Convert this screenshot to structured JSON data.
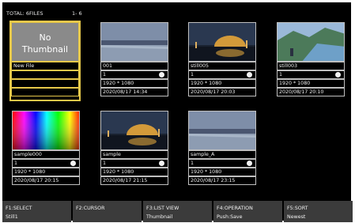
{
  "header": {
    "total": "TOTAL: 6FILES",
    "range": "1- 6"
  },
  "cards": [
    {
      "name": "New File",
      "no_thumb": "No\nThumbnail",
      "thumb": "none",
      "selected": true
    },
    {
      "name": "001",
      "count": "1",
      "res": "1920 * 1080",
      "date": "2020/08/17  14:34",
      "thumb": "lake"
    },
    {
      "name": "still005",
      "count": "1",
      "res": "1920 * 1080",
      "date": "2020/08/17  20:03",
      "thumb": "dome"
    },
    {
      "name": "still003",
      "count": "1",
      "res": "1920 * 1080",
      "date": "2020/08/17  20:10",
      "thumb": "mountain"
    },
    {
      "name": "sample000",
      "count": "1",
      "res": "1920 * 1080",
      "date": "2020/08/17  20:15",
      "thumb": "gradient"
    },
    {
      "name": "sample",
      "count": "1",
      "res": "1920 * 1080",
      "date": "2020/08/17  21:15",
      "thumb": "dome"
    },
    {
      "name": "sample_A",
      "count": "1",
      "res": "1920 * 1080",
      "date": "2020/08/17  23:15",
      "thumb": "lake"
    }
  ],
  "function_keys": [
    {
      "key": "F1:SELECT",
      "value": "Still1"
    },
    {
      "key": "F2:CURSOR",
      "value": ""
    },
    {
      "key": "F3:LIST VIEW",
      "value": "Thumbnail"
    },
    {
      "key": "F4:OPERATION",
      "value": "Push:Save"
    },
    {
      "key": "F5:SORT",
      "value": "Newest"
    }
  ],
  "colors": {
    "background": "#000000",
    "selected_border": "#e6c84a",
    "function_bar": "#3b3b3b",
    "placeholder": "#8a8a8a"
  }
}
